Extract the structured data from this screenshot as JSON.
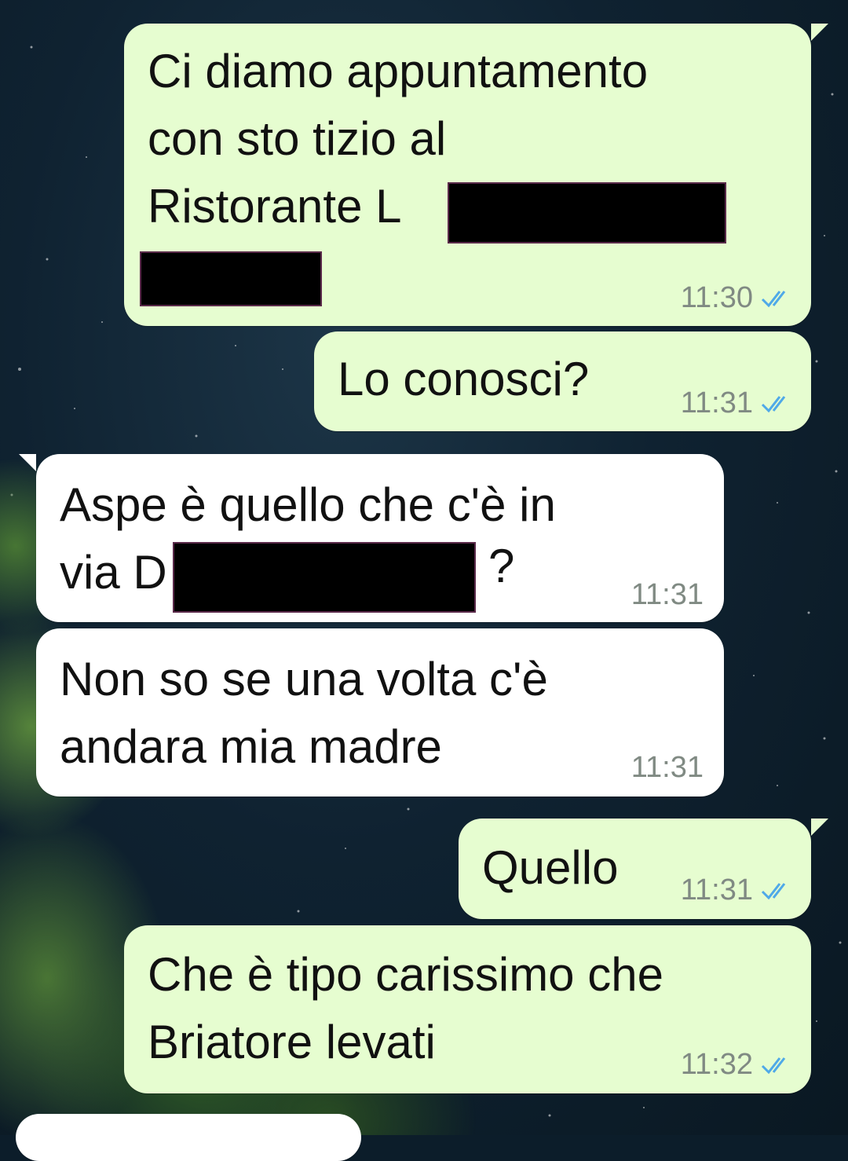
{
  "messages": [
    {
      "id": "m1",
      "direction": "out",
      "lines": [
        "Ci diamo appuntamento",
        "con sto tizio al",
        "Ristorante L"
      ],
      "time": "11:30",
      "status_icon": "double-check-blue-icon"
    },
    {
      "id": "m2",
      "direction": "out",
      "lines": [
        "Lo conosci?"
      ],
      "time": "11:31",
      "status_icon": "double-check-blue-icon"
    },
    {
      "id": "m3",
      "direction": "in",
      "lines": [
        "Aspe è quello che c'è in",
        "via D",
        "?"
      ],
      "time": "11:31"
    },
    {
      "id": "m4",
      "direction": "in",
      "lines": [
        "Non so se una volta c'è",
        "andara mia madre"
      ],
      "time": "11:31"
    },
    {
      "id": "m5",
      "direction": "out",
      "lines": [
        "Quello"
      ],
      "time": "11:31",
      "status_icon": "double-check-blue-icon"
    },
    {
      "id": "m6",
      "direction": "out",
      "lines": [
        "Che è tipo carissimo che",
        "Briatore levati"
      ],
      "time": "11:32",
      "status_icon": "double-check-blue-icon"
    }
  ],
  "colors": {
    "outgoing_bubble": "#e6fdd0",
    "incoming_bubble": "#ffffff",
    "tick_blue": "#4fa9e8",
    "redaction": "#000000"
  }
}
